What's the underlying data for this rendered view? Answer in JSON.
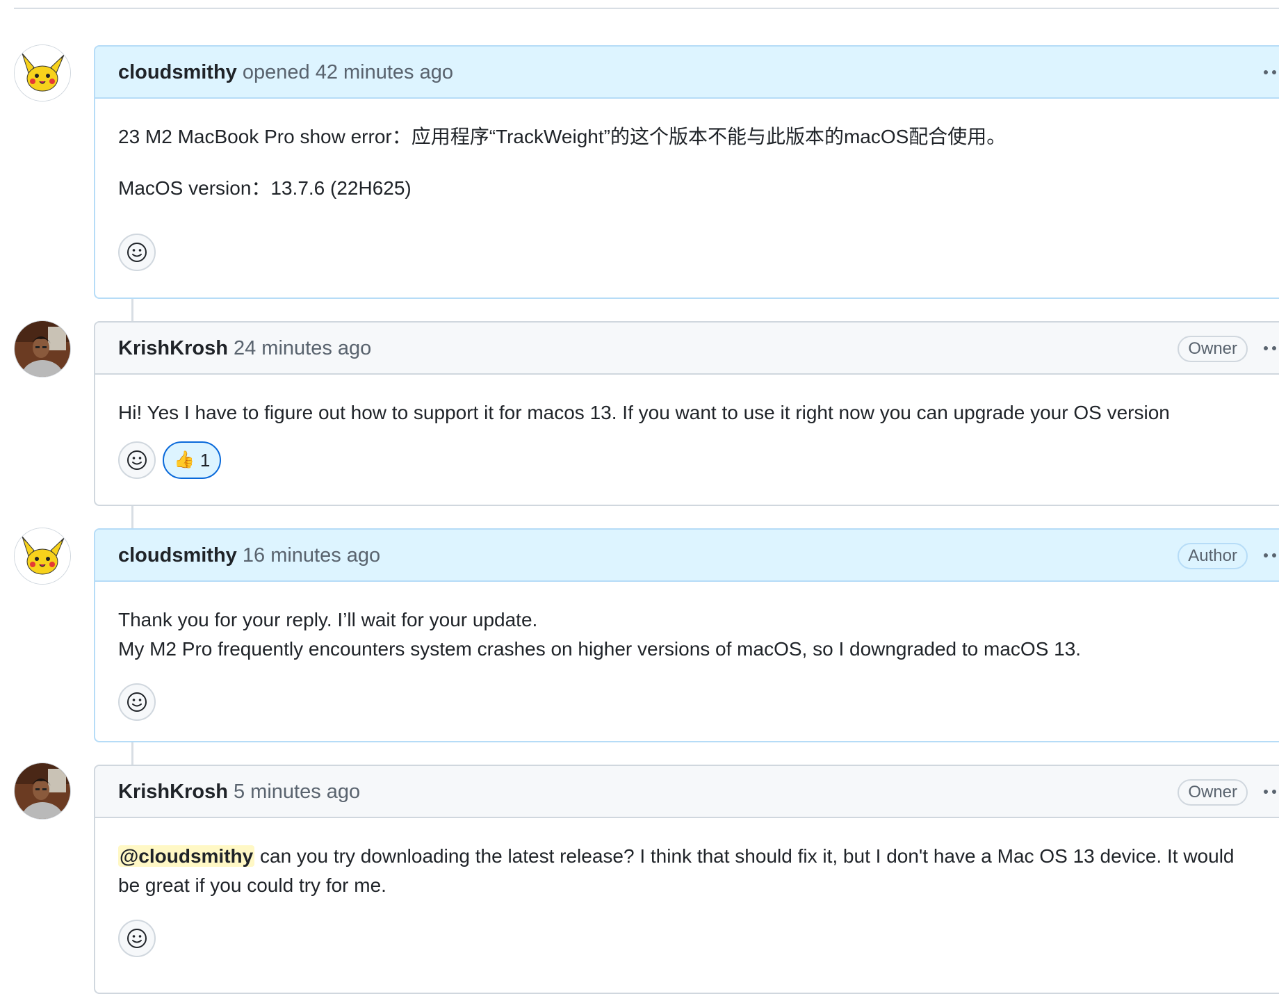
{
  "comments": [
    {
      "username": "cloudsmithy",
      "timestamp": "opened 42 minutes ago",
      "role": "",
      "avatar_icon": "pikachu-avatar",
      "body": [
        "23 M2 MacBook Pro show error：应用程序“TrackWeight”的这个版本不能与此版本的macOS配合使用。",
        "MacOS version：13.7.6 (22H625)"
      ]
    },
    {
      "username": "KrishKrosh",
      "timestamp": "24 minutes ago",
      "role": "Owner",
      "avatar_icon": "person-photo-avatar",
      "body": [
        "Hi! Yes I have to figure out how to support it for macos 13. If you want to use it right now you can upgrade your OS version"
      ],
      "reaction": {
        "emoji": "👍",
        "icon": "thumbs-up-icon",
        "count": "1"
      }
    },
    {
      "username": "cloudsmithy",
      "timestamp": "16 minutes ago",
      "role": "Author",
      "avatar_icon": "pikachu-avatar",
      "body": [
        "Thank you for your reply. I’ll wait for your update.",
        "My M2 Pro frequently encounters system crashes on higher versions of macOS, so I downgraded to macOS 13."
      ]
    },
    {
      "username": "KrishKrosh",
      "timestamp": "5 minutes ago",
      "role": "Owner",
      "avatar_icon": "person-photo-avatar",
      "mention": "@cloudsmithy",
      "body": [
        " can you try downloading the latest release? I think that should fix it, but I don't have a Mac OS 13 device. It would be great if you could try for me."
      ]
    }
  ],
  "colors": {
    "author_header_bg": "#ddf4ff",
    "author_border": "#b6dcf7",
    "owner_header_bg": "#f6f8fa",
    "border": "#d0d7de",
    "muted_text": "#59636e",
    "reaction_accent": "#0969da",
    "mention_highlight": "#fff8c5"
  },
  "icons": {
    "menu": "kebab-horizontal-icon",
    "add_reaction": "smiley-icon"
  }
}
